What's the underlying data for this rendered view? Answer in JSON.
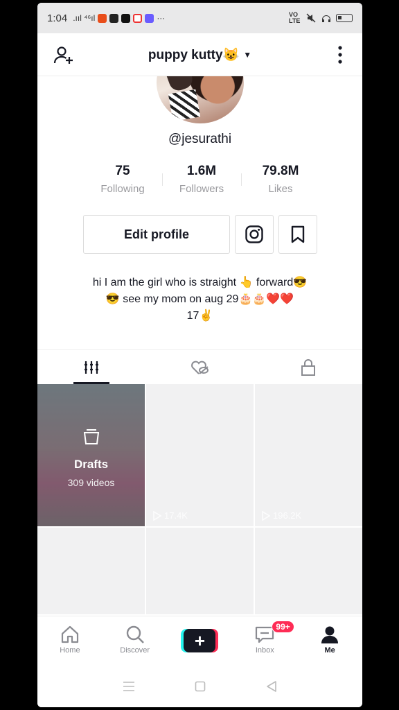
{
  "status_bar": {
    "time": "1:04",
    "signal_text": ".ııl ⁴⁶ıl",
    "more": "···",
    "network": "VO LTE"
  },
  "header": {
    "title": "puppy kutty😺",
    "add_user_icon": "add-user-icon",
    "more_icon": "more-vertical-icon"
  },
  "profile": {
    "username": "@jesurathi",
    "stats": [
      {
        "value": "75",
        "label": "Following"
      },
      {
        "value": "1.6M",
        "label": "Followers"
      },
      {
        "value": "79.8M",
        "label": "Likes"
      }
    ],
    "edit_label": "Edit profile",
    "bio": [
      "hi I am the girl who is straight 👆 forward😎",
      "😎 see my mom on aug 29🎂🎂❤️❤️",
      "17✌️"
    ]
  },
  "tabs": [
    "videos-grid-icon",
    "liked-hidden-icon",
    "private-lock-icon"
  ],
  "grid": {
    "draft_label": "Drafts",
    "draft_count": "309 videos",
    "views": [
      "17.4K",
      "196.2K"
    ]
  },
  "bottom_nav": {
    "home": "Home",
    "discover": "Discover",
    "create": "+",
    "inbox": "Inbox",
    "inbox_badge": "99+",
    "me": "Me"
  },
  "colors": {
    "accent_red": "#fe2c55",
    "accent_cyan": "#25f4ee",
    "text": "#161823"
  }
}
